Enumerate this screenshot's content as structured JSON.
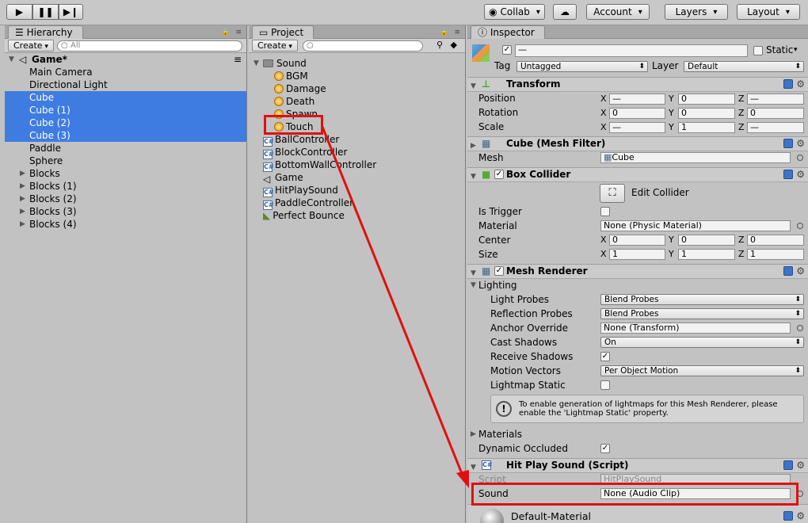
{
  "toolbar": {
    "collab": "Collab",
    "account": "Account",
    "layers": "Layers",
    "layout": "Layout"
  },
  "hierarchy": {
    "tab": "Hierarchy",
    "create": "Create",
    "search_placeholder": "All",
    "scene": "Game*",
    "items": [
      "Main Camera",
      "Directional Light",
      "Cube",
      "Cube (1)",
      "Cube (2)",
      "Cube (3)",
      "Paddle",
      "Sphere",
      "Blocks",
      "Blocks (1)",
      "Blocks (2)",
      "Blocks (3)",
      "Blocks (4)"
    ]
  },
  "project": {
    "tab": "Project",
    "create": "Create",
    "folder": "Sound",
    "sounds": [
      "BGM",
      "Damage",
      "Death",
      "Spawn",
      "Touch"
    ],
    "assets": [
      "BallController",
      "BlockController",
      "BottomWallController",
      "Game",
      "HitPlaySound",
      "PaddleController",
      "Perfect Bounce"
    ]
  },
  "inspector": {
    "tab": "Inspector",
    "name_value": "—",
    "static_label": "Static",
    "tag_label": "Tag",
    "tag_value": "Untagged",
    "layer_label": "Layer",
    "layer_value": "Default",
    "transform": {
      "title": "Transform",
      "position": "Position",
      "rotation": "Rotation",
      "scale": "Scale",
      "pos": [
        "—",
        "0",
        "—"
      ],
      "rot": [
        "0",
        "0",
        "0"
      ],
      "scl": [
        "—",
        "1",
        "—"
      ]
    },
    "axes": {
      "x": "X",
      "y": "Y",
      "z": "Z"
    },
    "mesh_filter": {
      "title": "Cube (Mesh Filter)",
      "mesh_label": "Mesh",
      "mesh_value": "Cube"
    },
    "box_collider": {
      "title": "Box Collider",
      "edit": "Edit Collider",
      "is_trigger": "Is Trigger",
      "material": "Material",
      "material_value": "None (Physic Material)",
      "center": "Center",
      "size": "Size",
      "center_vals": [
        "0",
        "0",
        "0"
      ],
      "size_vals": [
        "1",
        "1",
        "1"
      ]
    },
    "mesh_renderer": {
      "title": "Mesh Renderer",
      "lighting": "Lighting",
      "light_probes": "Light Probes",
      "light_probes_value": "Blend Probes",
      "reflection_probes": "Reflection Probes",
      "reflection_probes_value": "Blend Probes",
      "anchor_override": "Anchor Override",
      "anchor_value": "None (Transform)",
      "cast_shadows": "Cast Shadows",
      "cast_value": "On",
      "receive_shadows": "Receive Shadows",
      "motion_vectors": "Motion Vectors",
      "motion_value": "Per Object Motion",
      "lightmap_static": "Lightmap Static",
      "info": "To enable generation of lightmaps for this Mesh Renderer, please enable the 'Lightmap Static' property.",
      "materials": "Materials",
      "dynamic_occluded": "Dynamic Occluded"
    },
    "hit_play_sound": {
      "title": "Hit Play Sound (Script)",
      "script_label": "Script",
      "script_value": "HitPlaySound",
      "sound_label": "Sound",
      "sound_value": "None (Audio Clip)"
    },
    "material": {
      "name": "Default-Material"
    }
  },
  "colors": {
    "selection": "#3e7ce1",
    "highlight": "#e01010"
  }
}
